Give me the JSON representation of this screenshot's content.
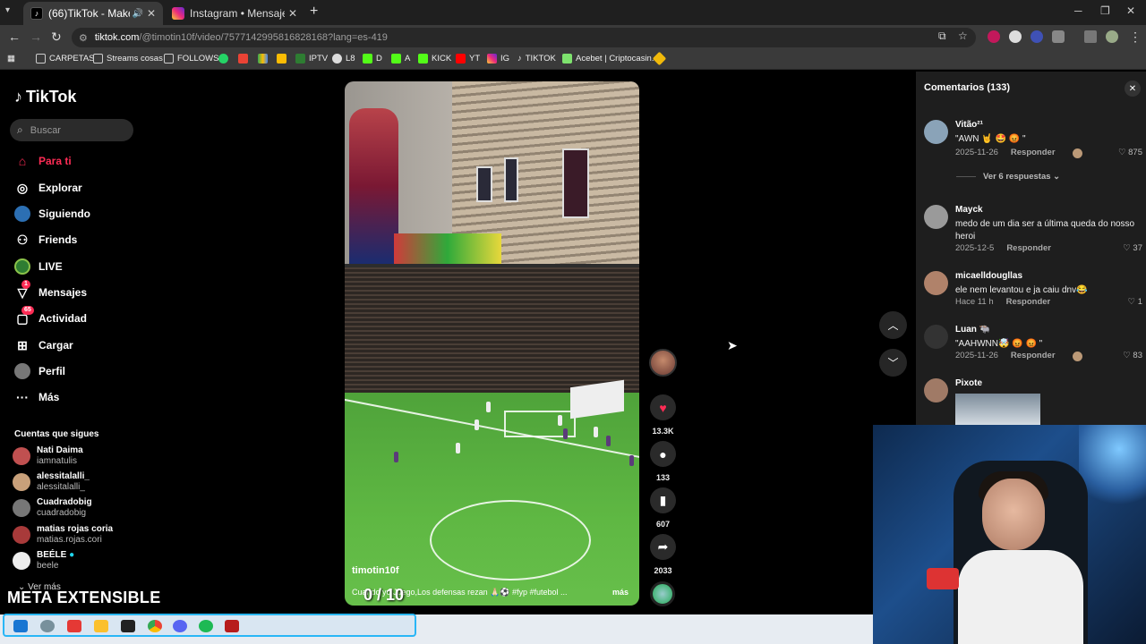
{
  "browser": {
    "tabs": [
      {
        "title": "(66)TikTok - Make Your Day",
        "color": "#ffffff"
      },
      {
        "title": "Instagram • Mensajes",
        "color": "#d62976"
      }
    ],
    "url_host": "tiktok.com",
    "url_path": "/@timotin10f/video/7577142995816828168?lang=es-419",
    "bookmarks": [
      {
        "label": "CARPETAS",
        "icon": "folder-icon",
        "color": "#cccccc"
      },
      {
        "label": "Streams cosas",
        "icon": "folder-icon",
        "color": "#cccccc"
      },
      {
        "label": "FOLLOWS",
        "icon": "folder-icon",
        "color": "#cccccc"
      },
      {
        "label": "",
        "icon": "whatsapp-icon",
        "color": "#25d366"
      },
      {
        "label": "",
        "icon": "gmail-icon",
        "color": "#ea4335"
      },
      {
        "label": "",
        "icon": "drive-icon",
        "color": "#34a853"
      },
      {
        "label": "",
        "icon": "keep-icon",
        "color": "#fbbc04"
      },
      {
        "label": "IPTV",
        "icon": "iptv-icon",
        "color": "#2e7d32"
      },
      {
        "label": "L8",
        "icon": "l8-icon",
        "color": "#dddddd"
      },
      {
        "label": "D",
        "icon": "kick-icon",
        "color": "#53fc18"
      },
      {
        "label": "A",
        "icon": "kick-icon",
        "color": "#53fc18"
      },
      {
        "label": "KICK",
        "icon": "kick-icon",
        "color": "#53fc18"
      },
      {
        "label": "YT",
        "icon": "youtube-icon",
        "color": "#ff0000"
      },
      {
        "label": "IG",
        "icon": "instagram-icon",
        "color": "#d62976"
      },
      {
        "label": "TIKTOK",
        "icon": "tiktok-icon",
        "color": "#ffffff"
      },
      {
        "label": "Acebet | Criptocasin...",
        "icon": "acebet-icon",
        "color": "#7ee26e"
      },
      {
        "label": "",
        "icon": "binance-icon",
        "color": "#f0b90b"
      }
    ]
  },
  "sidebar": {
    "brand": "TikTok",
    "search_placeholder": "Buscar",
    "nav": [
      {
        "label": "Para ti",
        "icon": "home-icon",
        "active": true
      },
      {
        "label": "Explorar",
        "icon": "compass-icon"
      },
      {
        "label": "Siguiendo",
        "icon": "following-icon"
      },
      {
        "label": "Friends",
        "icon": "friends-icon"
      },
      {
        "label": "LIVE",
        "icon": "live-icon"
      },
      {
        "label": "Mensajes",
        "icon": "messages-icon",
        "badge": "1"
      },
      {
        "label": "Actividad",
        "icon": "activity-icon",
        "badge": "65"
      },
      {
        "label": "Cargar",
        "icon": "upload-icon"
      },
      {
        "label": "Perfil",
        "icon": "profile-icon"
      },
      {
        "label": "Más",
        "icon": "more-icon"
      }
    ],
    "following_title": "Cuentas que sigues",
    "following": [
      {
        "name": "Nati Daima",
        "user": "iamnatulis",
        "color": "#c05050"
      },
      {
        "name": "alessitalalli_",
        "user": "alessitalalli_",
        "color": "#c8a07a"
      },
      {
        "name": "Cuadradobig",
        "user": "cuadradobig",
        "color": "#777777"
      },
      {
        "name": "matias rojas coria",
        "user": "matias.rojas.cori",
        "color": "#a83a3a"
      },
      {
        "name": "BEÉLE",
        "user": "beele",
        "color": "#eeeeee",
        "verified": true
      }
    ],
    "see_more": "Ver más",
    "overlay_title": "META EXTENSIBLE"
  },
  "video": {
    "username": "timotin10f",
    "description": "Cuando yo Juego,Los defensas rezan 🙏🏻⚽ #fyp #futebol ...",
    "more": "más",
    "score": "0 / 10",
    "likes": "13.3K",
    "comments": "133",
    "saves": "607",
    "shares": "2033"
  },
  "comments": {
    "title": "Comentarios",
    "count": "(133)",
    "reply_label": "Responder",
    "view_replies": "Ver 6 respuestas",
    "items": [
      {
        "user": "Vitão²¹",
        "text": "\"AWN 🤘 🤩 😡 \"",
        "date": "2025-11-26",
        "likes": "875",
        "color": "#8aa3b8"
      },
      {
        "user": "Mayck",
        "text": "medo de um dia ser a última queda do nosso heroi",
        "date": "2025-12-5",
        "likes": "37",
        "color": "#9a9a9a"
      },
      {
        "user": "micaelldougllas",
        "text": "ele nem levantou e ja caiu dnv😂",
        "date": "Hace 11 h",
        "likes": "1",
        "color": "#b0826a"
      },
      {
        "user": "Luan 🐃",
        "text": "\"AAHWNN🤯 😡 😡 \"",
        "date": "2025-11-26",
        "likes": "83",
        "color": "#333333"
      },
      {
        "user": "Pixote",
        "text": "",
        "date": "",
        "likes": "",
        "color": "#a07a66"
      }
    ]
  },
  "accent": "#fe2c55"
}
